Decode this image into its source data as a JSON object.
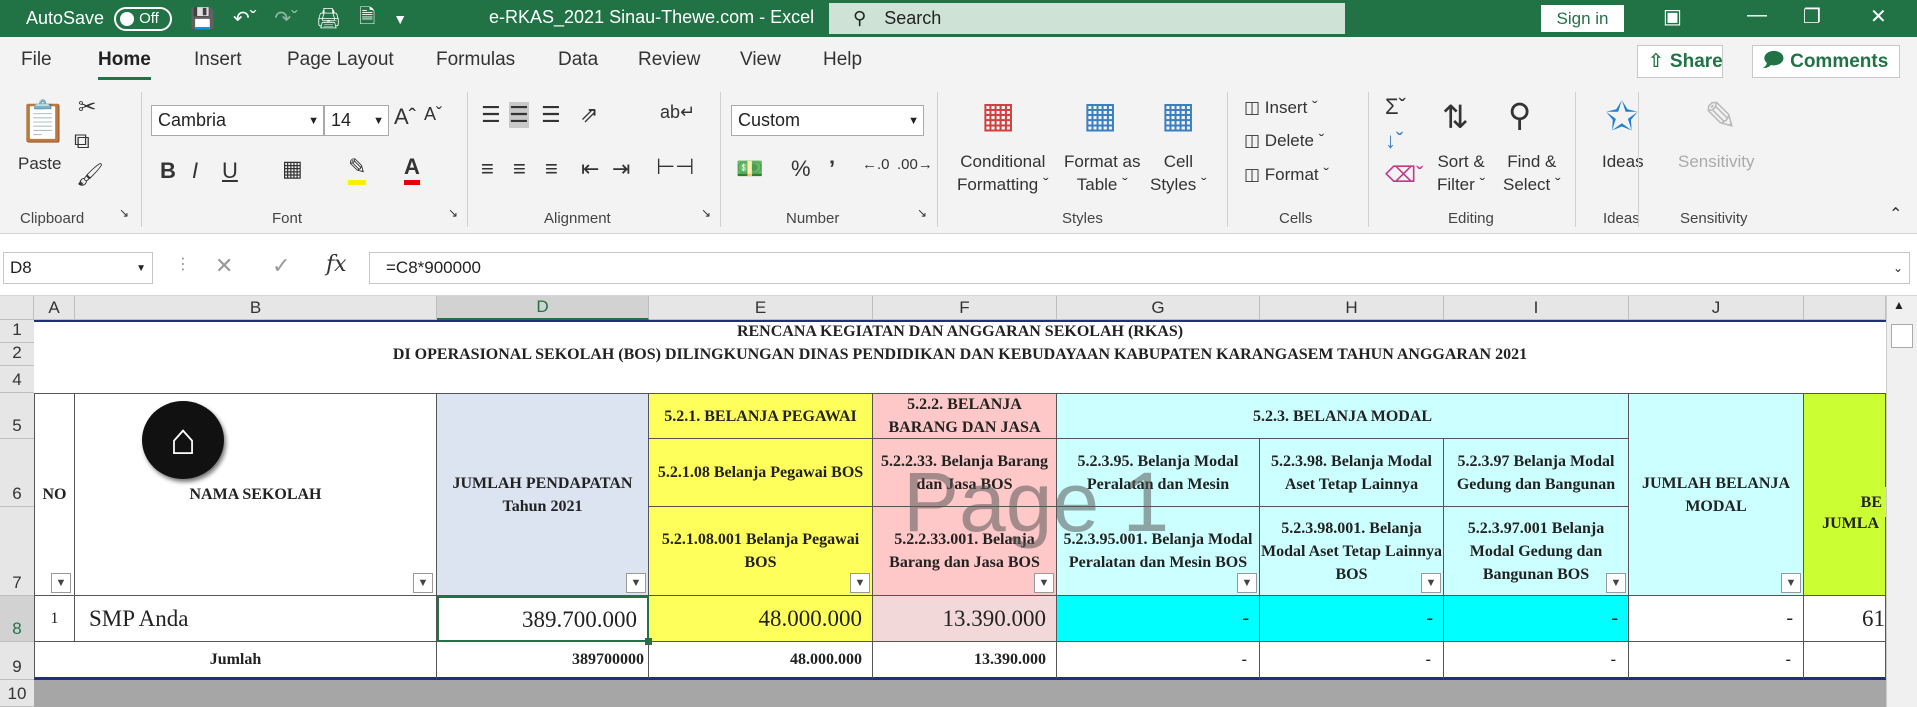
{
  "titlebar": {
    "autosave_label": "AutoSave",
    "autosave_state": "Off",
    "doc_title": "e-RKAS_2021 Sinau-Thewe.com  -  Excel",
    "search_placeholder": "Search",
    "signin_label": "Sign in"
  },
  "menu": {
    "tabs": [
      "File",
      "Home",
      "Insert",
      "Page Layout",
      "Formulas",
      "Data",
      "Review",
      "View",
      "Help"
    ],
    "active_tab": "Home",
    "share_label": "Share",
    "comments_label": "Comments"
  },
  "ribbon": {
    "paste_label": "Paste",
    "font_name": "Cambria",
    "font_size": "14",
    "number_format": "Custom",
    "conditional_formatting": [
      "Conditional",
      "Formatting"
    ],
    "format_as_table": [
      "Format as",
      "Table"
    ],
    "cell_styles": [
      "Cell",
      "Styles"
    ],
    "insert_label": "Insert",
    "delete_label": "Delete",
    "format_label": "Format",
    "sort_filter": [
      "Sort &",
      "Filter"
    ],
    "find_select": [
      "Find &",
      "Select"
    ],
    "ideas_label": "Ideas",
    "sensitivity_label": "Sensitivity",
    "groups": [
      "Clipboard",
      "Font",
      "Alignment",
      "Number",
      "Styles",
      "Cells",
      "Editing",
      "Ideas",
      "Sensitivity"
    ]
  },
  "formula_bar": {
    "name_box": "D8",
    "formula": "=C8*900000"
  },
  "columns": [
    "A",
    "B",
    "D",
    "E",
    "F",
    "G",
    "H",
    "I",
    "J"
  ],
  "rows": [
    "1",
    "2",
    "4",
    "5",
    "6",
    "7",
    "8",
    "9",
    "10"
  ],
  "sheet": {
    "title1": "RENCANA KEGIATAN DAN ANGGARAN SEKOLAH (RKAS)",
    "title2": "DI OPERASIONAL SEKOLAH (BOS) DILINGKUNGAN DINAS PENDIDIKAN DAN KEBUDAYAAN  KABUPATEN KARANGASEM TAHUN ANGGARAN 2021",
    "no": "NO",
    "nama_sekolah": "NAMA SEKOLAH",
    "jumlah_pendapatan": "JUMLAH PENDAPATAN Tahun 2021",
    "belanja_pegawai": "5.2.1. BELANJA PEGAWAI",
    "belanja_pegawai_bos": "5.2.1.08 Belanja Pegawai BOS",
    "belanja_pegawai_bos_detail": "5.2.1.08.001 Belanja Pegawai BOS",
    "belanja_barang": "5.2.2. BELANJA BARANG DAN JASA",
    "belanja_barang_bos": "5.2.2.33. Belanja Barang dan Jasa BOS",
    "belanja_barang_bos_detail": "5.2.2.33.001. Belanja Barang dan Jasa BOS",
    "belanja_modal": "5.2.3. BELANJA MODAL",
    "modal_peralatan": "5.2.3.95. Belanja Modal Peralatan dan Mesin",
    "modal_peralatan_detail": "5.2.3.95.001. Belanja Modal Peralatan dan Mesin BOS",
    "modal_aset": "5.2.3.98.  Belanja Modal Aset Tetap Lainnya",
    "modal_aset_detail": "5.2.3.98.001. Belanja Modal Aset Tetap Lainnya BOS",
    "modal_gedung": "5.2.3.97  Belanja Modal Gedung dan Bangunan",
    "modal_gedung_detail": "5.2.3.97.001 Belanja Modal Gedung dan Bangunan BOS",
    "jumlah_belanja_modal": "JUMLAH BELANJA MODAL",
    "jumlah_cut": "JUMLA",
    "jumlah_cut2": "BE",
    "row8": {
      "no": "1",
      "nama": "SMP Anda",
      "pendapatan": "389.700.000",
      "pegawai": "48.000.000",
      "barang": "13.390.000",
      "g": "-",
      "h": "-",
      "i": "-",
      "j": "-",
      "k": "61"
    },
    "row9": {
      "label": "Jumlah",
      "pendapatan": "389700000",
      "pegawai": "48.000.000",
      "barang": "13.390.000",
      "g": "-",
      "h": "-",
      "i": "-",
      "j": "-"
    },
    "watermark": "Page 1"
  }
}
